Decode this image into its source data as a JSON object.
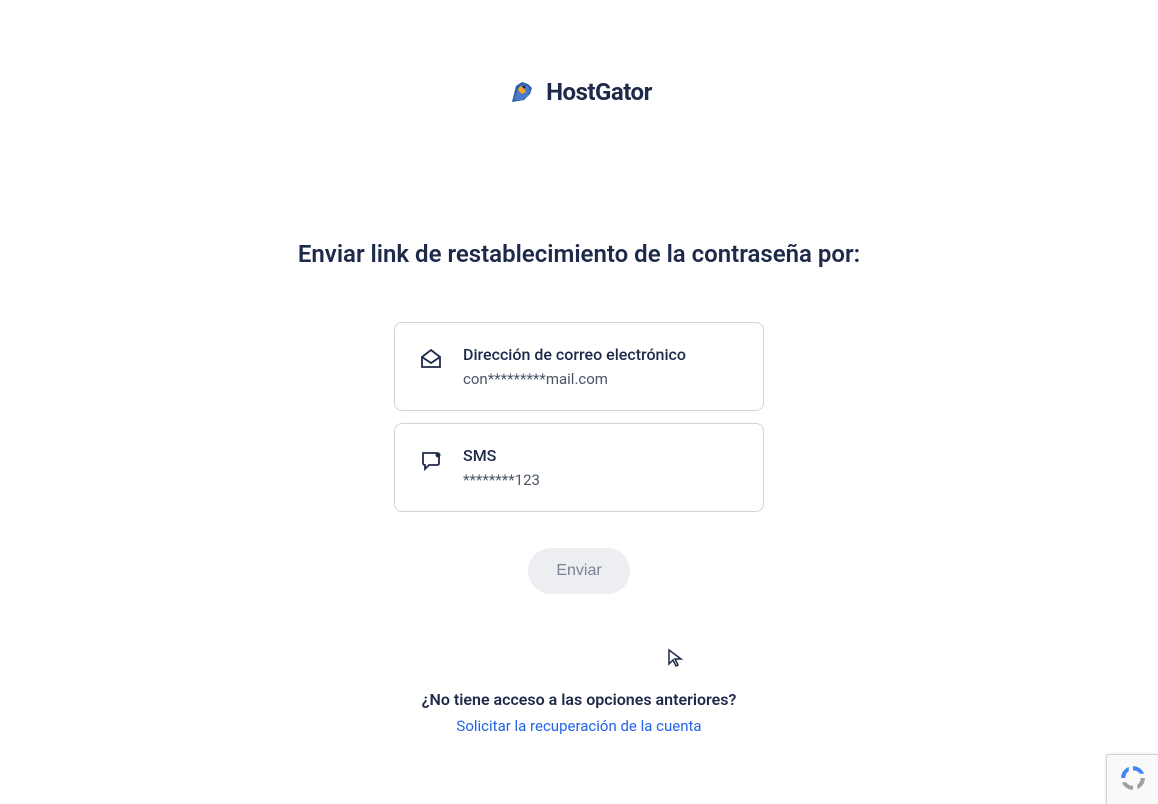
{
  "brand": {
    "name": "HostGator"
  },
  "heading": "Enviar link de restablecimiento de la contraseña por:",
  "options": {
    "email": {
      "label": "Dirección de correo electrónico",
      "value": "con*********mail.com"
    },
    "sms": {
      "label": "SMS",
      "value": "********123"
    }
  },
  "submit_label": "Enviar",
  "footer": {
    "question": "¿No tiene acceso a las opciones anteriores?",
    "link_text": "Solicitar la recuperación de la cuenta"
  }
}
